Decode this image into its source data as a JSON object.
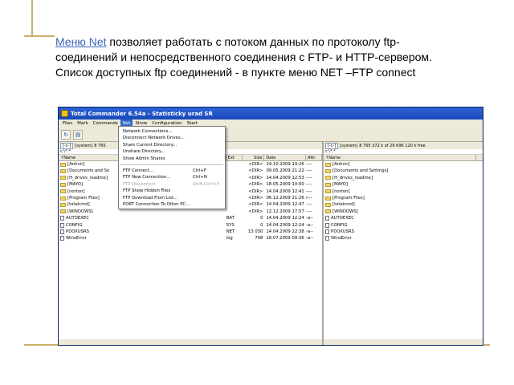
{
  "caption": {
    "link": "Меню Net",
    "text": " позволяет работать с потоком данных по протоколу ftp-соединений и непосредственного соединения с FTP- и HTTP-сервером.  Список доступных ftp соединений - в пункте мeню NET –FTP connect"
  },
  "window": {
    "title": "Total Commander 6.54a - Statisticky urad SR",
    "menu": [
      "Files",
      "Mark",
      "Commands",
      "Net",
      "Show",
      "Configuration",
      "Start"
    ],
    "active_menu_index": 3,
    "toolbar_icons": [
      "refresh-icon",
      "view-icon"
    ],
    "colors": {
      "title_bar": "#1a48b8",
      "menu_highlight": "#316ac5",
      "folder": "#f3d46b"
    }
  },
  "left_panel": {
    "drive": "[-c-]",
    "drive_label": "[system]",
    "free_info": "8 765",
    "path": "c:\\*.*",
    "headers": {
      "name": "↑Name",
      "ext": "Ext",
      "size": "Size",
      "date": "Date",
      "attr": "Attr"
    },
    "rows": [
      {
        "type": "folder",
        "name": "[Antivir]",
        "ext": "",
        "size": "<DIR>",
        "date": "24.10.2009 19:26",
        "attr": "----"
      },
      {
        "type": "folder",
        "name": "[Documents and Se",
        "ext": "",
        "size": "<DIR>",
        "date": "09.05.2009 21:22",
        "attr": "----"
      },
      {
        "type": "folder",
        "name": "[H_drives_readme]",
        "ext": "",
        "size": "<DIR>",
        "date": "14.04.2009 12:53",
        "attr": "----"
      },
      {
        "type": "folder",
        "name": "[MAYO]",
        "ext": "",
        "size": "<DIR>",
        "date": "18.05.2009 10:00",
        "attr": "----"
      },
      {
        "type": "folder",
        "name": "[norton]",
        "ext": "",
        "size": "<DIR>",
        "date": "14.04.2009 12:41",
        "attr": "----"
      },
      {
        "type": "folder",
        "name": "[Program Files]",
        "ext": "",
        "size": "<DIR>",
        "date": "06.12.2009 21:26",
        "attr": "r---"
      },
      {
        "type": "folder",
        "name": "[totalcmd]",
        "ext": "",
        "size": "<DIR>",
        "date": "14.04.2009 12:47",
        "attr": "----"
      },
      {
        "type": "folder",
        "name": "[WINDOWS]",
        "ext": "",
        "size": "<DIR>",
        "date": "12.12.2009 17:57",
        "attr": "----"
      },
      {
        "type": "file",
        "name": "AUTOEXEC",
        "ext": "BAT",
        "size": "0",
        "date": "14.04.2009 12:24",
        "attr": "-a--"
      },
      {
        "type": "file",
        "name": "CONFIG",
        "ext": "SYS",
        "size": "0",
        "date": "14.04.2009 12:24",
        "attr": "-a--"
      },
      {
        "type": "file",
        "name": "PDOXUSRS",
        "ext": "NET",
        "size": "13 030",
        "date": "14.04.2009 22:38",
        "attr": "-a--"
      },
      {
        "type": "file",
        "name": "WinsError",
        "ext": "log",
        "size": "798",
        "date": "18.07.2009 09:36",
        "attr": "-a--"
      }
    ]
  },
  "right_panel": {
    "drive": "[-c-]",
    "drive_label": "[system]",
    "free_info": "8 765 372 k of 29 696 120 k free",
    "path": "c:\\*.*",
    "headers": {
      "name": "↑Name"
    },
    "rows": [
      {
        "type": "folder",
        "name": "[Antivir]"
      },
      {
        "type": "folder",
        "name": "[Documents and Settings]"
      },
      {
        "type": "folder",
        "name": "[H_drives_readme]"
      },
      {
        "type": "folder",
        "name": "[MAYO]"
      },
      {
        "type": "folder",
        "name": "[norton]"
      },
      {
        "type": "folder",
        "name": "[Program Files]"
      },
      {
        "type": "folder",
        "name": "[totalcmd]"
      },
      {
        "type": "folder",
        "name": "[WINDOWS]"
      },
      {
        "type": "file",
        "name": "AUTOEXEC"
      },
      {
        "type": "file",
        "name": "CONFIG"
      },
      {
        "type": "file",
        "name": "PDOXUSRS"
      },
      {
        "type": "file",
        "name": "WinsError"
      }
    ]
  },
  "net_menu": {
    "groups": [
      [
        {
          "label": "Network Connections...",
          "shortcut": "",
          "disabled": false
        },
        {
          "label": "Disconnect Network Drives...",
          "shortcut": "",
          "disabled": false
        },
        {
          "label": "Share Current Directory...",
          "shortcut": "",
          "disabled": false
        },
        {
          "label": "Unshare Directory...",
          "shortcut": "",
          "disabled": false
        },
        {
          "label": "Show Admin Shares",
          "shortcut": "",
          "disabled": false
        }
      ],
      [
        {
          "label": "FTP Connect...",
          "shortcut": "Ctrl+F",
          "disabled": false
        },
        {
          "label": "FTP New Connection...",
          "shortcut": "Ctrl+N",
          "disabled": false
        },
        {
          "label": "FTP Disconnect",
          "shortcut": "Shift+Ctrl+F",
          "disabled": true
        },
        {
          "label": "FTP Show Hidden Files",
          "shortcut": "",
          "disabled": false
        },
        {
          "label": "FTP Download From List...",
          "shortcut": "",
          "disabled": false
        },
        {
          "label": "PORT Connection To Other PC...",
          "shortcut": "",
          "disabled": false
        }
      ]
    ]
  }
}
